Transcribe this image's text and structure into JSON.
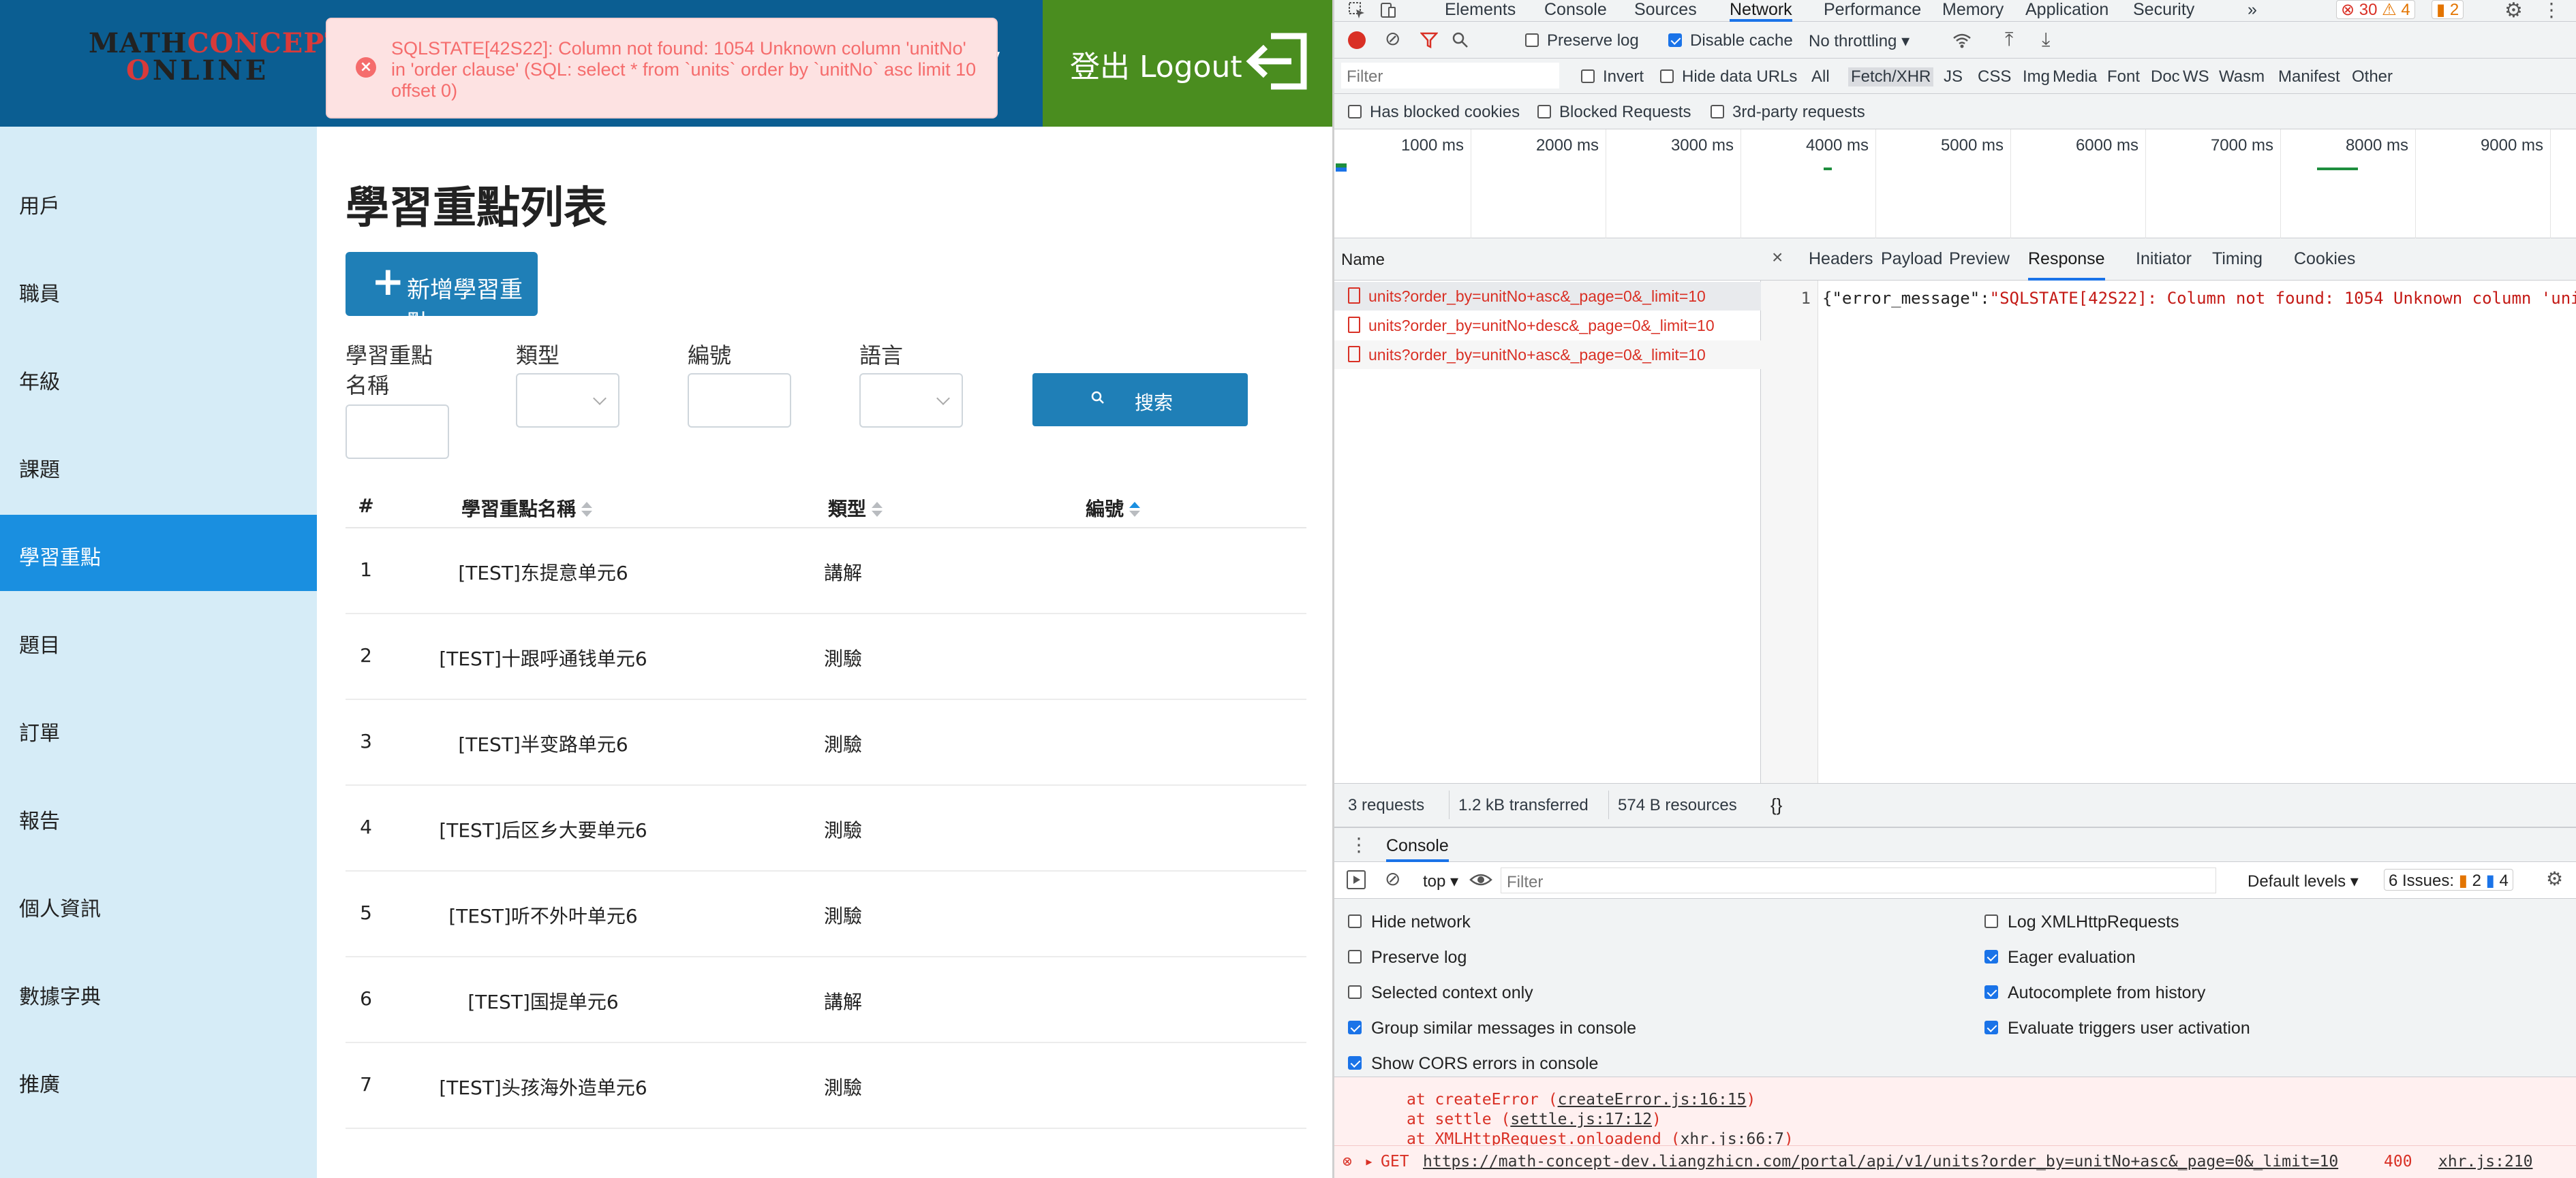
{
  "app": {
    "logo": {
      "line1_a": "MATH",
      "line1_b": "CONCEPT",
      "line2_a": "O",
      "line2_b": "NLINE"
    },
    "header_partial_text": "ly",
    "logout_label": "登出 Logout",
    "error_toast": "SQLSTATE[42S22]: Column not found: 1054 Unknown column 'unitNo' in 'order clause' (SQL: select * from `units` order by `unitNo` asc limit 10 offset 0)",
    "sidebar": [
      {
        "label": "用戶"
      },
      {
        "label": "職員"
      },
      {
        "label": "年級"
      },
      {
        "label": "課題"
      },
      {
        "label": "學習重點"
      },
      {
        "label": "題目"
      },
      {
        "label": "訂單"
      },
      {
        "label": "報告"
      },
      {
        "label": "個人資訊"
      },
      {
        "label": "數據字典"
      },
      {
        "label": "推廣"
      }
    ],
    "active_sidebar": "學習重點",
    "page_title": "學習重點列表",
    "add_button": "新增學習重點",
    "filters": {
      "name_label_1": "學習重點",
      "name_label_2": "名稱",
      "type_label": "類型",
      "code_label": "編號",
      "lang_label": "語言",
      "search_button": "搜索"
    },
    "table": {
      "headers": [
        "#",
        "學習重點名稱",
        "類型",
        "編號"
      ],
      "rows": [
        {
          "no": "1",
          "name": "[TEST]东提意单元6",
          "type": "講解",
          "code": ""
        },
        {
          "no": "2",
          "name": "[TEST]十跟呼通钱单元6",
          "type": "測驗",
          "code": ""
        },
        {
          "no": "3",
          "name": "[TEST]半变路单元6",
          "type": "測驗",
          "code": ""
        },
        {
          "no": "4",
          "name": "[TEST]后区乡大要单元6",
          "type": "測驗",
          "code": ""
        },
        {
          "no": "5",
          "name": "[TEST]听不外叶单元6",
          "type": "測驗",
          "code": ""
        },
        {
          "no": "6",
          "name": "[TEST]国提单元6",
          "type": "講解",
          "code": ""
        },
        {
          "no": "7",
          "name": "[TEST]头孩海外造单元6",
          "type": "測驗",
          "code": ""
        }
      ]
    }
  },
  "devtools": {
    "tabs": [
      "Elements",
      "Console",
      "Sources",
      "Network",
      "Performance",
      "Memory",
      "Application",
      "Security",
      "»"
    ],
    "active_tab": "Network",
    "badges": {
      "errors": "30",
      "warnings": "4",
      "issues": "2"
    },
    "toolbar1": {
      "preserve_log": "Preserve log",
      "disable_cache": "Disable cache",
      "throttling": "No throttling"
    },
    "toolbar2": {
      "filter_placeholder": "Filter",
      "invert": "Invert",
      "hide_data_urls": "Hide data URLs",
      "types": [
        "All",
        "Fetch/XHR",
        "JS",
        "CSS",
        "Img",
        "Media",
        "Font",
        "Doc",
        "WS",
        "Wasm",
        "Manifest",
        "Other"
      ],
      "active_type": "Fetch/XHR"
    },
    "toolbar3": {
      "blocked_cookies": "Has blocked cookies",
      "blocked_requests": "Blocked Requests",
      "third_party": "3rd-party requests"
    },
    "timeline_ticks": [
      "1000 ms",
      "2000 ms",
      "3000 ms",
      "4000 ms",
      "5000 ms",
      "6000 ms",
      "7000 ms",
      "8000 ms",
      "9000 ms"
    ],
    "requests_header": "Name",
    "requests": [
      "units?order_by=unitNo+asc&_page=0&_limit=10",
      "units?order_by=unitNo+desc&_page=0&_limit=10",
      "units?order_by=unitNo+asc&_page=0&_limit=10"
    ],
    "detail_tabs": [
      "Headers",
      "Payload",
      "Preview",
      "Response",
      "Initiator",
      "Timing",
      "Cookies"
    ],
    "active_detail_tab": "Response",
    "response_line_no": "1",
    "response_key": "{\"error_message\":",
    "response_val": "\"SQLSTATE[42S22]: Column not found: 1054 Unknown column 'uni",
    "status": {
      "requests": "3 requests",
      "transferred": "1.2 kB transferred",
      "resources": "574 B resources",
      "braces": "{}"
    },
    "console": {
      "tab": "Console",
      "context": "top",
      "filter_placeholder": "Filter",
      "levels": "Default levels",
      "issues_label": "6 Issues:",
      "issues_warn": "2",
      "issues_info": "4",
      "settings_left": [
        {
          "label": "Hide network",
          "checked": false
        },
        {
          "label": "Preserve log",
          "checked": false
        },
        {
          "label": "Selected context only",
          "checked": false
        },
        {
          "label": "Group similar messages in console",
          "checked": true
        },
        {
          "label": "Show CORS errors in console",
          "checked": true
        }
      ],
      "settings_right": [
        {
          "label": "Log XMLHttpRequests",
          "checked": false
        },
        {
          "label": "Eager evaluation",
          "checked": true
        },
        {
          "label": "Autocomplete from history",
          "checked": true
        },
        {
          "label": "Evaluate triggers user activation",
          "checked": true
        }
      ],
      "stack": [
        {
          "prefix": "at createError (",
          "file": "createError.js:16:15",
          "suffix": ")"
        },
        {
          "prefix": "at settle (",
          "file": "settle.js:17:12",
          "suffix": ")"
        },
        {
          "prefix": "at XMLHttpRequest.onloadend (",
          "file": "xhr.js:66:7",
          "suffix": ")"
        }
      ],
      "get_method": "GET",
      "get_url": "https://math-concept-dev.liangzhicn.com/portal/api/v1/units?order_by=unitNo+asc&_page=0&_limit=10",
      "get_status": "400",
      "get_source": "xhr.js:210"
    }
  },
  "colors": {
    "header_blue": "#0b5e92",
    "logout_green": "#4a8d1f",
    "sidebar_bg": "#d6ecf7",
    "sidebar_active": "#1a8fe0",
    "button_blue": "#1f7fb7",
    "error_red": "#f56c6c"
  }
}
